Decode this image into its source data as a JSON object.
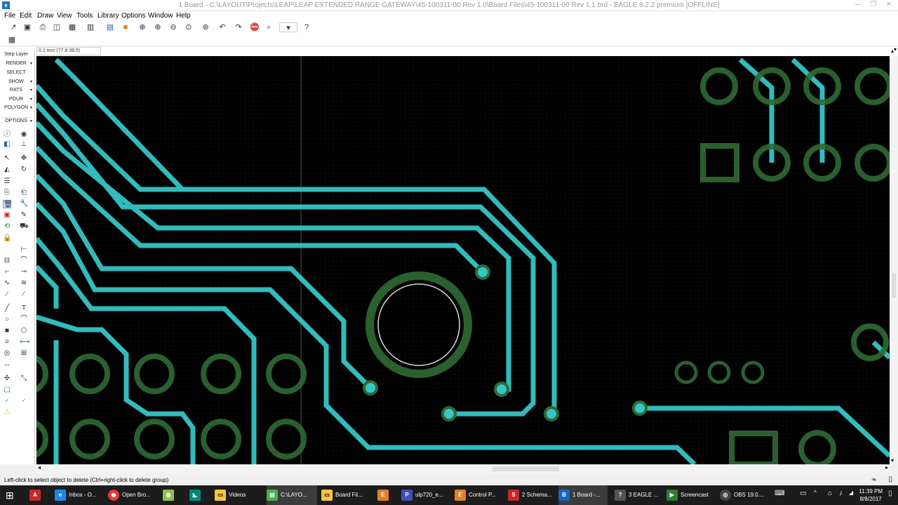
{
  "window": {
    "title": "1 Board - C:\\LAYOUT\\Projects\\LEAP\\LEAP EXTENDED RANGE GATEWAY\\45-100311-00 Rev 1.0\\Board Files\\45-100311-00 Rev 1.1.brd - EAGLE 8.2.2 premium [OFFLINE]",
    "minimize": "—",
    "maximize": "❐",
    "close": "✕"
  },
  "menu": [
    "File",
    "Edit",
    "Draw",
    "View",
    "Tools",
    "Library",
    "Options",
    "Window",
    "Help"
  ],
  "coord": "0.1 mm (77.8 39.5)",
  "left_panel": {
    "step_layer": "Step Layer",
    "labels": [
      "RENDER",
      "SELECT",
      "SHOW",
      "RATS",
      "POUR",
      "POLYGON",
      "OPTIONS"
    ]
  },
  "status": "Left-click to select object to delete (Ctrl+right-click to delete group)",
  "taskbar": {
    "items": [
      {
        "label": "Inbox - O...",
        "icon": "ie-icon",
        "color": "#1e88e5"
      },
      {
        "label": "Open Bro...",
        "icon": "chrome-icon",
        "color": "#e53935"
      },
      {
        "label": "Videos",
        "icon": "folder-icon",
        "color": "#f4c542"
      },
      {
        "label": "C:\\LAYO...",
        "icon": "explorer-icon",
        "color": "#4caf50"
      },
      {
        "label": "Board Fil...",
        "icon": "folder-icon",
        "color": "#f4c542"
      },
      {
        "label": "ulp720_e...",
        "icon": "pdf-icon",
        "color": "#3f51b5"
      },
      {
        "label": "Control P...",
        "icon": "eagle-icon",
        "color": "#e67e22"
      },
      {
        "label": "2 Schema...",
        "icon": "sch-icon",
        "color": "#c62828"
      },
      {
        "label": "1 Board -...",
        "icon": "brd-icon",
        "color": "#1565c0"
      },
      {
        "label": "3 EAGLE ...",
        "icon": "help-icon",
        "color": "#555555"
      },
      {
        "label": "Screencast",
        "icon": "screencast-icon",
        "color": "#2e7d32"
      },
      {
        "label": "OBS 19.0....",
        "icon": "obs-icon",
        "color": "#444444"
      }
    ],
    "time": "11:39 PM",
    "date": "8/8/2017"
  },
  "colors": {
    "trace": "#35c6c8",
    "pad": "#2f6a33",
    "canvas": "#000000"
  }
}
